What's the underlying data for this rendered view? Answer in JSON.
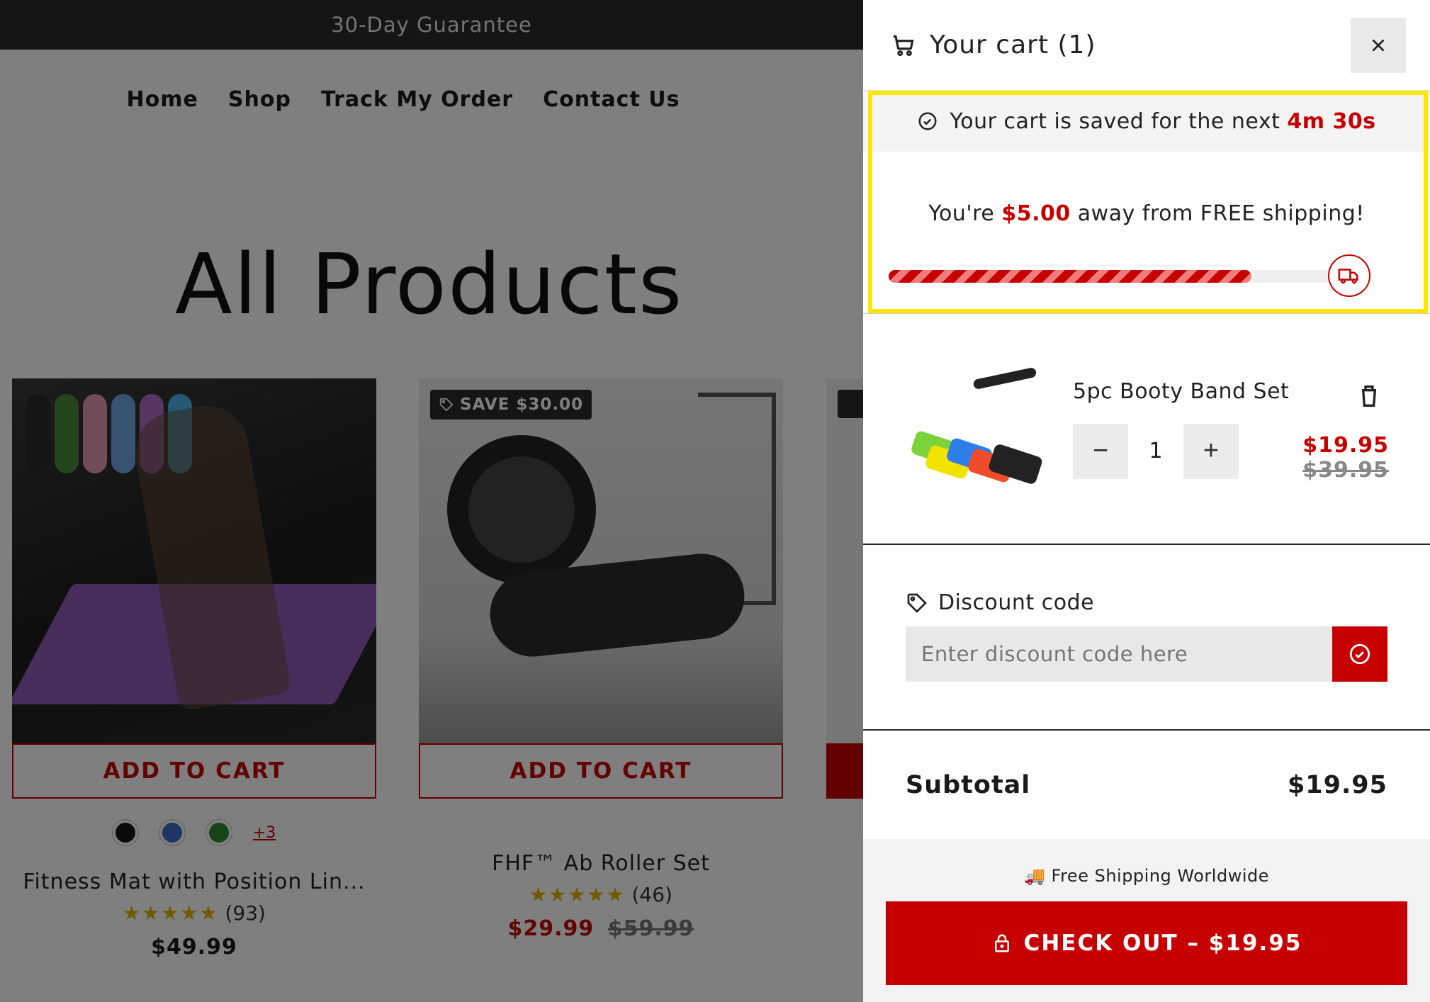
{
  "store": {
    "announcement": "30-Day Guarantee",
    "nav": [
      "Home",
      "Shop",
      "Track My Order",
      "Contact Us"
    ],
    "page_title": "All Products",
    "products": [
      {
        "add_to_cart": "ADD TO CART",
        "swatch_colors": [
          "#151515",
          "#3b6fc4",
          "#2f8a2f"
        ],
        "more_swatches": "+3",
        "name": "Fitness Mat with Position Lin...",
        "stars": "★★★★★",
        "reviews": "(93)",
        "price": "$49.99"
      },
      {
        "badge": "SAVE $30.00",
        "add_to_cart": "ADD TO CART",
        "name": "FHF™ Ab Roller Set",
        "stars": "★★★★★",
        "reviews": "(46)",
        "sale_price": "$29.99",
        "compare_price": "$59.99"
      }
    ]
  },
  "cart": {
    "title": "Your cart (1)",
    "icons": {
      "cart": "cart-icon",
      "close": "close-icon",
      "check": "check-circle-icon",
      "truck": "truck-icon",
      "trash": "trash-icon",
      "tag": "tag-icon",
      "lock": "lock-icon"
    },
    "saved_prefix": "Your cart is saved for the next",
    "saved_timer": "4m 30s",
    "shipping_prefix": "You're",
    "shipping_amount": "$5.00",
    "shipping_suffix": "away from FREE shipping!",
    "shipping_progress": 0.8,
    "item": {
      "name": "5pc Booty Band Set",
      "quantity": "1",
      "minus": "−",
      "plus": "+",
      "price": "$19.95",
      "compare_price": "$39.95"
    },
    "discount": {
      "label": "Discount code",
      "placeholder": "Enter discount code here"
    },
    "subtotal_label": "Subtotal",
    "subtotal_value": "$19.95",
    "free_shipping_note": "🚚 Free Shipping Worldwide",
    "checkout_label": "CHECK OUT – $19.95",
    "accent_color": "#c60000",
    "highlight_color": "#ffe600"
  }
}
